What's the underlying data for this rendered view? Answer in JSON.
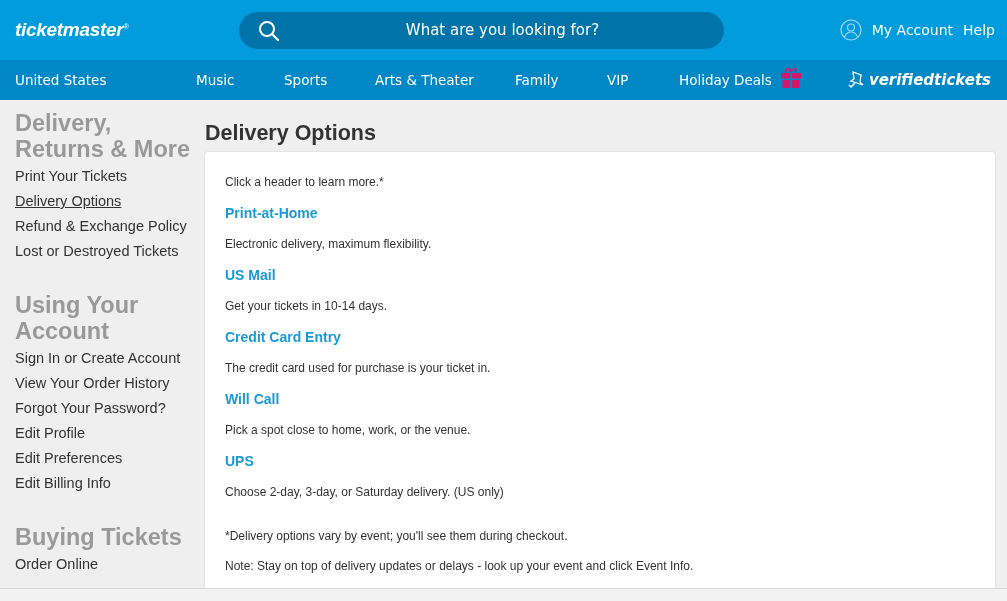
{
  "header": {
    "logo": "ticketmaster",
    "logo_mark": "®",
    "search": {
      "placeholder": "What are you looking for?"
    },
    "account": "My Account",
    "help": "Help"
  },
  "nav": {
    "country": "United States",
    "items": [
      "Music",
      "Sports",
      "Arts & Theater",
      "Family",
      "VIP",
      "Holiday Deals"
    ],
    "brand": "verifiedtickets"
  },
  "sidebar": [
    {
      "title": "Delivery, Returns & More",
      "items": [
        {
          "label": "Print Your Tickets",
          "selected": false
        },
        {
          "label": "Delivery Options",
          "selected": true
        },
        {
          "label": "Refund & Exchange Policy",
          "selected": false
        },
        {
          "label": "Lost or Destroyed Tickets",
          "selected": false
        }
      ]
    },
    {
      "title": "Using Your Account",
      "items": [
        {
          "label": "Sign In or Create Account",
          "selected": false
        },
        {
          "label": "View Your Order History",
          "selected": false
        },
        {
          "label": "Forgot Your Password?",
          "selected": false
        },
        {
          "label": "Edit Profile",
          "selected": false
        },
        {
          "label": "Edit Preferences",
          "selected": false
        },
        {
          "label": "Edit Billing Info",
          "selected": false
        }
      ]
    },
    {
      "title": "Buying Tickets",
      "items": [
        {
          "label": "Order Online",
          "selected": false
        }
      ]
    }
  ],
  "main": {
    "title": "Delivery Options",
    "intro": "Click a header to learn more.*",
    "options": [
      {
        "header": "Print-at-Home",
        "text": "Electronic delivery, maximum flexibility."
      },
      {
        "header": "US Mail",
        "text": "Get your tickets in 10-14 days."
      },
      {
        "header": "Credit Card Entry",
        "text": "The credit card used for purchase is your ticket in."
      },
      {
        "header": "Will Call",
        "text": "Pick a spot close to home, work, or the venue."
      },
      {
        "header": "UPS",
        "text": "Choose 2-day, 3-day, or Saturday delivery. (US only)"
      }
    ],
    "notes": [
      "*Delivery options vary by event; you'll see them during checkout.",
      "Note: Stay on top of delivery updates or delays - look up your event and click Event Info."
    ]
  }
}
